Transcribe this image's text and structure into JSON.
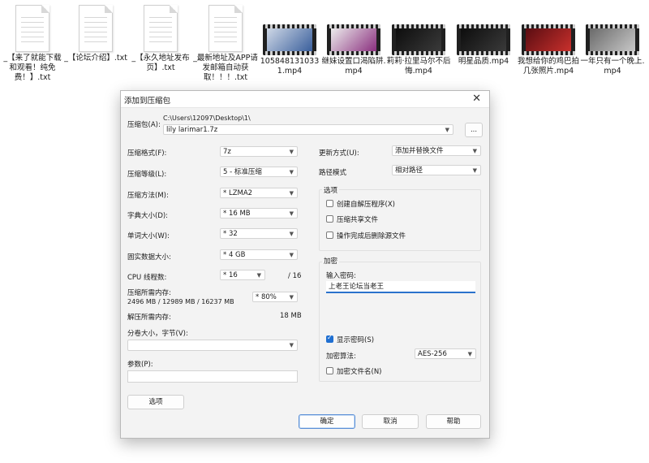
{
  "desktop": {
    "txt_files": [
      {
        "label": "_【来了就能下载和观看！纯免费！】.txt"
      },
      {
        "label": "_【论坛介绍】.txt"
      },
      {
        "label": "_【永久地址发布页】.txt"
      },
      {
        "label": "_最新地址及APP请发邮箱自动获取！！！.txt"
      }
    ],
    "mp4_files": [
      {
        "label": "1058481310331.mp4",
        "colors": [
          "#cfd8e6",
          "#3a5f9c"
        ]
      },
      {
        "label": "继妹设置口渴陷阱.mp4",
        "colors": [
          "#ececec",
          "#8a2f7e"
        ]
      },
      {
        "label": "莉莉·拉里马尔不后悔.mp4",
        "colors": [
          "#0d0d0d",
          "#3a3a3a"
        ]
      },
      {
        "label": "明星品质.mp4",
        "colors": [
          "#0d0d0d",
          "#3a3a3a"
        ]
      },
      {
        "label": "我想给你的鸡巴拍几张照片.mp4",
        "colors": [
          "#5a0d12",
          "#c9302c"
        ]
      },
      {
        "label": "一年只有一个晚上.mp4",
        "colors": [
          "#6a6a6a",
          "#c8c8c8"
        ]
      }
    ]
  },
  "dialog": {
    "title": "添加到压缩包",
    "archive_label": "压缩包(A):",
    "path": "C:\\Users\\12097\\Desktop\\1\\",
    "archive_name": "lily larimar1.7z",
    "browse_label": "...",
    "left_fields": [
      {
        "label": "压缩格式(F):",
        "value": "7z"
      },
      {
        "label": "压缩等级(L):",
        "value": "5 - 标准压缩"
      },
      {
        "label": "压缩方法(M):",
        "value": "* LZMA2"
      },
      {
        "label": "字典大小(D):",
        "value": "* 16 MB"
      },
      {
        "label": "单词大小(W):",
        "value": "* 32"
      },
      {
        "label": "固实数据大小:",
        "value": "* 4 GB"
      }
    ],
    "cpu_label": "CPU 线程数:",
    "cpu_value": "* 16",
    "cpu_total": "/ 16",
    "mem_comp_label": "压缩所需内存:",
    "mem_comp_values": "2496 MB / 12989 MB / 16237 MB",
    "mem_percent": "* 80%",
    "mem_decomp_label": "解压所需内存:",
    "mem_decomp_value": "18 MB",
    "split_label": "分卷大小，字节(V):",
    "params_label": "参数(P):",
    "options_button": "选项",
    "update_label": "更新方式(U):",
    "update_value": "添加并替换文件",
    "path_mode_label": "路径模式",
    "path_mode_value": "相对路径",
    "options_group": "选项",
    "options": [
      {
        "label": "创建自解压程序(X)",
        "checked": false
      },
      {
        "label": "压缩共享文件",
        "checked": false
      },
      {
        "label": "操作完成后删除源文件",
        "checked": false
      }
    ],
    "encryption_group": "加密",
    "password_label": "输入密码:",
    "password_value": "上老王论坛当老王",
    "show_password_label": "显示密码(S)",
    "show_password_checked": true,
    "enc_method_label": "加密算法:",
    "enc_method_value": "AES-256",
    "encrypt_names_label": "加密文件名(N)",
    "ok_label": "确定",
    "cancel_label": "取消",
    "help_label": "帮助"
  }
}
